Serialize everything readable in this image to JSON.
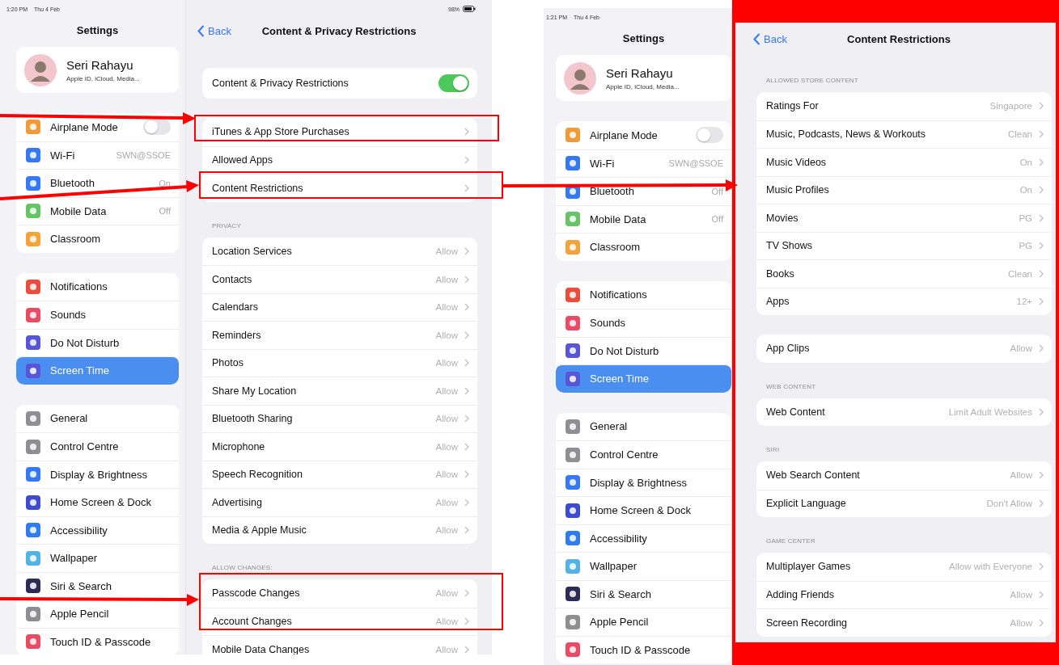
{
  "screens": [
    {
      "status_bar": {
        "time": "1:20 PM",
        "date": "Thu 4 Feb",
        "battery": "98%"
      },
      "sidebar": {
        "title": "Settings",
        "profile": {
          "name": "Seri Rahayu",
          "subtitle": "Apple ID, iCloud, Media..."
        },
        "groups": [
          {
            "items": [
              {
                "label": "Airplane Mode",
                "kind": "toggle",
                "on": false,
                "color": "#f19a37",
                "selected": false
              },
              {
                "label": "Wi-Fi",
                "kind": "value",
                "value": "SWN@SSOE",
                "color": "#3478f6",
                "selected": false
              },
              {
                "label": "Bluetooth",
                "kind": "value",
                "value": "On",
                "color": "#3478f6",
                "selected": false
              },
              {
                "label": "Mobile Data",
                "kind": "value",
                "value": "Off",
                "color": "#65c466",
                "selected": false
              },
              {
                "label": "Classroom",
                "kind": "link",
                "color": "#f3a33a",
                "selected": false
              }
            ]
          },
          {
            "items": [
              {
                "label": "Notifications",
                "kind": "link",
                "color": "#eb4d3d",
                "selected": false
              },
              {
                "label": "Sounds",
                "kind": "link",
                "color": "#eb4b62",
                "selected": false
              },
              {
                "label": "Do Not Disturb",
                "kind": "link",
                "color": "#5856d6",
                "selected": false
              },
              {
                "label": "Screen Time",
                "kind": "link",
                "color": "#5856d6",
                "selected": true
              }
            ]
          },
          {
            "items": [
              {
                "label": "General",
                "kind": "link",
                "color": "#8e8e93",
                "selected": false
              },
              {
                "label": "Control Centre",
                "kind": "link",
                "color": "#8e8e93",
                "selected": false
              },
              {
                "label": "Display & Brightness",
                "kind": "link",
                "color": "#3478f6",
                "selected": false
              },
              {
                "label": "Home Screen & Dock",
                "kind": "link",
                "color": "#3d4bd1",
                "selected": false
              },
              {
                "label": "Accessibility",
                "kind": "link",
                "color": "#2f7cf0",
                "selected": false
              },
              {
                "label": "Wallpaper",
                "kind": "link",
                "color": "#52b3e8",
                "selected": false
              },
              {
                "label": "Siri & Search",
                "kind": "link",
                "color": "#2c2c54",
                "selected": false
              },
              {
                "label": "Apple Pencil",
                "kind": "link",
                "color": "#8e8e93",
                "selected": false
              },
              {
                "label": "Touch ID & Passcode",
                "kind": "link",
                "color": "#eb4b62",
                "selected": false
              }
            ]
          }
        ]
      },
      "detail": {
        "back": "Back",
        "title": "Content & Privacy Restrictions",
        "framed": false,
        "sections": [
          {
            "rows": [
              {
                "label": "Content & Privacy Restrictions",
                "kind": "toggle",
                "on": true
              }
            ]
          },
          {
            "rows": [
              {
                "label": "iTunes & App Store Purchases",
                "kind": "link"
              },
              {
                "label": "Allowed Apps",
                "kind": "link"
              },
              {
                "label": "Content Restrictions",
                "kind": "link"
              }
            ]
          },
          {
            "header": "PRIVACY",
            "rows": [
              {
                "label": "Location Services",
                "kind": "link",
                "value": "Allow"
              },
              {
                "label": "Contacts",
                "kind": "link",
                "value": "Allow"
              },
              {
                "label": "Calendars",
                "kind": "link",
                "value": "Allow"
              },
              {
                "label": "Reminders",
                "kind": "link",
                "value": "Allow"
              },
              {
                "label": "Photos",
                "kind": "link",
                "value": "Allow"
              },
              {
                "label": "Share My Location",
                "kind": "link",
                "value": "Allow"
              },
              {
                "label": "Bluetooth Sharing",
                "kind": "link",
                "value": "Allow"
              },
              {
                "label": "Microphone",
                "kind": "link",
                "value": "Allow"
              },
              {
                "label": "Speech Recognition",
                "kind": "link",
                "value": "Allow"
              },
              {
                "label": "Advertising",
                "kind": "link",
                "value": "Allow"
              },
              {
                "label": "Media & Apple Music",
                "kind": "link",
                "value": "Allow"
              }
            ]
          },
          {
            "header": "ALLOW CHANGES:",
            "rows": [
              {
                "label": "Passcode Changes",
                "kind": "link",
                "value": "Allow"
              },
              {
                "label": "Account Changes",
                "kind": "link",
                "value": "Allow"
              },
              {
                "label": "Mobile Data Changes",
                "kind": "link",
                "value": "Allow"
              }
            ]
          }
        ]
      }
    },
    {
      "status_bar": {
        "time": "1:21 PM",
        "date": "Thu 4 Feb"
      },
      "sidebar": {
        "title": "Settings",
        "profile": {
          "name": "Seri Rahayu",
          "subtitle": "Apple ID, iCloud, Media..."
        },
        "groups": [
          {
            "items": [
              {
                "label": "Airplane Mode",
                "kind": "toggle",
                "on": false,
                "color": "#f19a37",
                "selected": false
              },
              {
                "label": "Wi-Fi",
                "kind": "value",
                "value": "SWN@SSOE",
                "color": "#3478f6",
                "selected": false
              },
              {
                "label": "Bluetooth",
                "kind": "value",
                "value": "Off",
                "color": "#3478f6",
                "selected": false
              },
              {
                "label": "Mobile Data",
                "kind": "value",
                "value": "Off",
                "color": "#65c466",
                "selected": false
              },
              {
                "label": "Classroom",
                "kind": "link",
                "color": "#f3a33a",
                "selected": false
              }
            ]
          },
          {
            "items": [
              {
                "label": "Notifications",
                "kind": "link",
                "color": "#eb4d3d",
                "selected": false
              },
              {
                "label": "Sounds",
                "kind": "link",
                "color": "#eb4b62",
                "selected": false
              },
              {
                "label": "Do Not Disturb",
                "kind": "link",
                "color": "#5856d6",
                "selected": false
              },
              {
                "label": "Screen Time",
                "kind": "link",
                "color": "#5856d6",
                "selected": true
              }
            ]
          },
          {
            "items": [
              {
                "label": "General",
                "kind": "link",
                "color": "#8e8e93",
                "selected": false
              },
              {
                "label": "Control Centre",
                "kind": "link",
                "color": "#8e8e93",
                "selected": false
              },
              {
                "label": "Display & Brightness",
                "kind": "link",
                "color": "#3478f6",
                "selected": false
              },
              {
                "label": "Home Screen & Dock",
                "kind": "link",
                "color": "#3d4bd1",
                "selected": false
              },
              {
                "label": "Accessibility",
                "kind": "link",
                "color": "#2f7cf0",
                "selected": false
              },
              {
                "label": "Wallpaper",
                "kind": "link",
                "color": "#52b3e8",
                "selected": false
              },
              {
                "label": "Siri & Search",
                "kind": "link",
                "color": "#2c2c54",
                "selected": false
              },
              {
                "label": "Apple Pencil",
                "kind": "link",
                "color": "#8e8e93",
                "selected": false
              },
              {
                "label": "Touch ID & Passcode",
                "kind": "link",
                "color": "#eb4b62",
                "selected": false
              }
            ]
          }
        ]
      },
      "detail": {
        "back": "Back",
        "title": "Content Restrictions",
        "framed": true,
        "sections": [
          {
            "header": "ALLOWED STORE CONTENT",
            "rows": [
              {
                "label": "Ratings For",
                "kind": "link",
                "value": "Singapore"
              },
              {
                "label": "Music, Podcasts, News & Workouts",
                "kind": "link",
                "value": "Clean"
              },
              {
                "label": "Music Videos",
                "kind": "link",
                "value": "On"
              },
              {
                "label": "Music Profiles",
                "kind": "link",
                "value": "On"
              },
              {
                "label": "Movies",
                "kind": "link",
                "value": "PG"
              },
              {
                "label": "TV Shows",
                "kind": "link",
                "value": "PG"
              },
              {
                "label": "Books",
                "kind": "link",
                "value": "Clean"
              },
              {
                "label": "Apps",
                "kind": "link",
                "value": "12+"
              }
            ]
          },
          {
            "rows": [
              {
                "label": "App Clips",
                "kind": "link",
                "value": "Allow"
              }
            ]
          },
          {
            "header": "WEB CONTENT",
            "rows": [
              {
                "label": "Web Content",
                "kind": "link",
                "value": "Limit Adult Websites"
              }
            ]
          },
          {
            "header": "SIRI",
            "rows": [
              {
                "label": "Web Search Content",
                "kind": "link",
                "value": "Allow"
              },
              {
                "label": "Explicit Language",
                "kind": "link",
                "value": "Don't Allow"
              }
            ]
          },
          {
            "header": "GAME CENTER",
            "rows": [
              {
                "label": "Multiplayer Games",
                "kind": "link",
                "value": "Allow with Everyone"
              },
              {
                "label": "Adding Friends",
                "kind": "link",
                "value": "Allow"
              },
              {
                "label": "Screen Recording",
                "kind": "link",
                "value": "Allow"
              }
            ]
          }
        ]
      }
    }
  ]
}
